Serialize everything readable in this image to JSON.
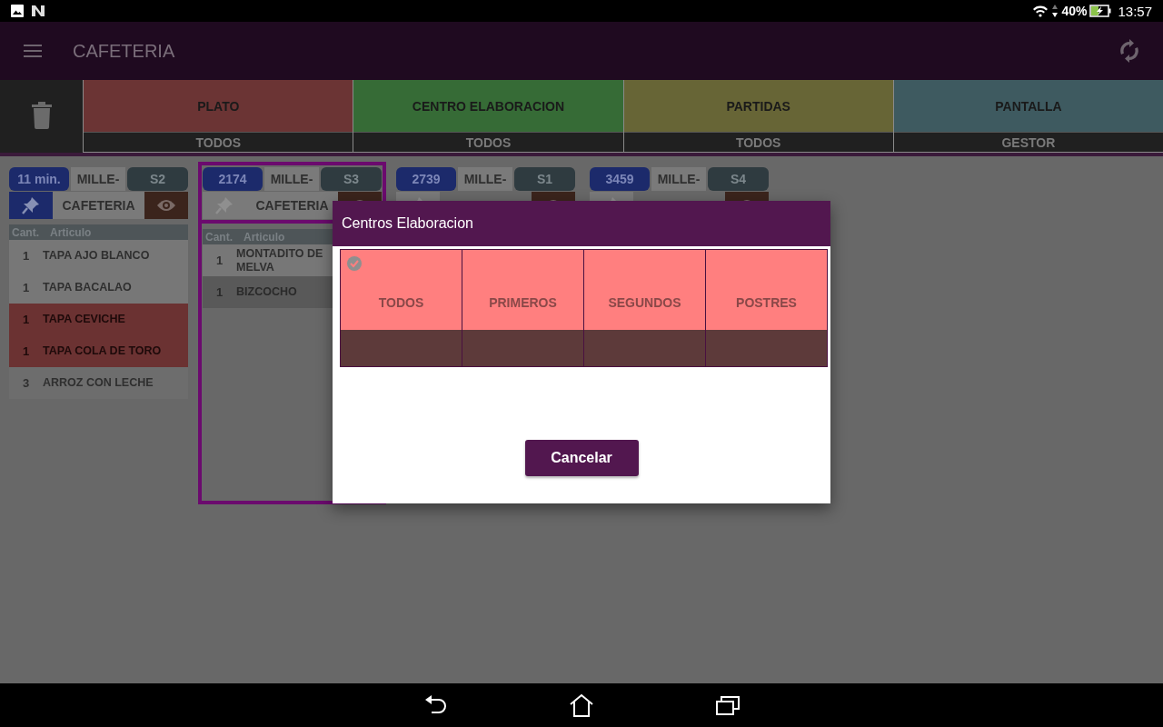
{
  "status_bar": {
    "battery": "40%",
    "time": "13:57"
  },
  "app_bar": {
    "title": "CAFETERIA"
  },
  "filters": [
    {
      "label": "PLATO",
      "value": "TODOS",
      "color": "#6b3434"
    },
    {
      "label": "CENTRO ELABORACION",
      "value": "TODOS",
      "color": "#366b36"
    },
    {
      "label": "PARTIDAS",
      "value": "TODOS",
      "color": "#676536"
    },
    {
      "label": "PANTALLA",
      "value": "GESTOR",
      "color": "#3e5a60"
    }
  ],
  "orders": [
    {
      "badge": "11 min.",
      "user": "MILLE-",
      "seat": "S2",
      "pinned": true,
      "selected": false,
      "location": "CAFETERIA",
      "columns": [
        "Cant.",
        "Articulo"
      ],
      "items": [
        {
          "qty": "1",
          "name": "TAPA AJO BLANCO",
          "kind": "plain"
        },
        {
          "qty": "1",
          "name": "TAPA BACALAO",
          "kind": "plain"
        },
        {
          "qty": "1",
          "name": "TAPA CEVICHE",
          "kind": "alert"
        },
        {
          "qty": "1",
          "name": "TAPA COLA DE TORO",
          "kind": "alert"
        },
        {
          "qty": "3",
          "name": "ARROZ CON LECHE",
          "kind": "muted"
        }
      ]
    },
    {
      "badge": "2174",
      "user": "MILLE-",
      "seat": "S3",
      "pinned": false,
      "selected": true,
      "location": "CAFETERIA",
      "columns": [
        "Cant.",
        "Articulo"
      ],
      "items": [
        {
          "qty": "1",
          "name": "MONTADITO DE MELVA",
          "kind": "plain"
        },
        {
          "qty": "1",
          "name": "BIZCOCHO",
          "kind": "dark"
        }
      ]
    },
    {
      "badge": "2739",
      "user": "MILLE-",
      "seat": "S1",
      "pinned": false,
      "selected": false
    },
    {
      "badge": "3459",
      "user": "MILLE-",
      "seat": "S4",
      "pinned": false,
      "selected": false
    }
  ],
  "dialog": {
    "title": "Centros Elaboracion",
    "options": [
      {
        "label": "TODOS",
        "selected": true
      },
      {
        "label": "PRIMEROS",
        "selected": false
      },
      {
        "label": "SEGUNDOS",
        "selected": false
      },
      {
        "label": "POSTRES",
        "selected": false
      }
    ],
    "buttons": [
      "Cancelar"
    ]
  }
}
